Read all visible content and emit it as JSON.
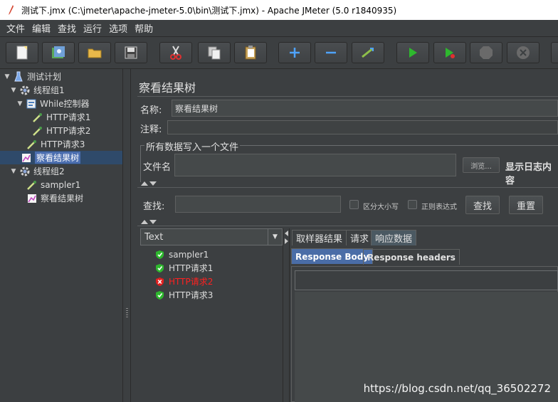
{
  "window": {
    "title": "测试下.jmx (C:\\jmeter\\apache-jmeter-5.0\\bin\\测试下.jmx) - Apache JMeter (5.0 r1840935)"
  },
  "menu": [
    "文件",
    "编辑",
    "查找",
    "运行",
    "选项",
    "帮助"
  ],
  "toolbar": [
    {
      "name": "new",
      "icon": "new-file-icon"
    },
    {
      "name": "templates",
      "icon": "templates-icon"
    },
    {
      "name": "open",
      "icon": "open-folder-icon"
    },
    {
      "name": "save",
      "icon": "save-icon"
    },
    {
      "name": "cut",
      "icon": "scissors-icon"
    },
    {
      "name": "copy",
      "icon": "copy-icon"
    },
    {
      "name": "paste",
      "icon": "paste-icon"
    },
    {
      "name": "expand",
      "icon": "plus-icon"
    },
    {
      "name": "collapse",
      "icon": "minus-icon"
    },
    {
      "name": "toggle",
      "icon": "toggle-wand-icon"
    },
    {
      "name": "start",
      "icon": "play-icon"
    },
    {
      "name": "start-no-pause",
      "icon": "play-no-timer-icon"
    },
    {
      "name": "stop",
      "icon": "stop-icon"
    },
    {
      "name": "shutdown",
      "icon": "shutdown-icon"
    }
  ],
  "tree": {
    "items": [
      {
        "label": "测试计划",
        "level": 0,
        "icon": "flask-icon",
        "expanded": true
      },
      {
        "label": "线程组1",
        "level": 1,
        "icon": "gear-icon",
        "expanded": true
      },
      {
        "label": "While控制器",
        "level": 2,
        "icon": "controller-icon",
        "expanded": true
      },
      {
        "label": "HTTP请求1",
        "level": 3,
        "icon": "pipette-icon"
      },
      {
        "label": "HTTP请求2",
        "level": 3,
        "icon": "pipette-icon"
      },
      {
        "label": "HTTP请求3",
        "level": 2,
        "icon": "pipette-icon"
      },
      {
        "label": "察看结果树",
        "level": 1,
        "icon": "chart-icon",
        "selected": true
      },
      {
        "label": "线程组2",
        "level": 1,
        "icon": "gear-icon",
        "expanded": true
      },
      {
        "label": "sampler1",
        "level": 2,
        "icon": "pipette-icon"
      },
      {
        "label": "察看结果树",
        "level": 2,
        "icon": "chart-icon"
      }
    ]
  },
  "panel": {
    "title": "察看结果树",
    "name_label": "名称:",
    "name_value": "察看结果树",
    "comment_label": "注释:",
    "comment_value": "",
    "file_group_title": "所有数据写入一个文件",
    "filename_label": "文件名",
    "filename_value": "",
    "browse_label": "浏览...",
    "log_only_label": "显示日志内容",
    "search_label": "查找:",
    "search_value": "",
    "case_label": "区分大小写",
    "regex_label": "正则表达式",
    "find_button": "查找",
    "reset_button": "重置"
  },
  "results": {
    "renderer": "Text",
    "items": [
      {
        "label": "sampler1",
        "status": "success"
      },
      {
        "label": "HTTP请求1",
        "status": "success"
      },
      {
        "label": "HTTP请求2",
        "status": "failure"
      },
      {
        "label": "HTTP请求3",
        "status": "success"
      }
    ]
  },
  "tabs": [
    "取样器结果",
    "请求",
    "响应数据"
  ],
  "active_tab": "响应数据",
  "subtabs": [
    "Response Body",
    "Response headers"
  ],
  "active_subtab": "Response Body",
  "watermark": "https://blog.csdn.net/qq_36502272",
  "colors": {
    "background": "#3c3f41",
    "selection": "#4b6eaf",
    "success": "#2eb82e",
    "failure": "#ff2020"
  }
}
